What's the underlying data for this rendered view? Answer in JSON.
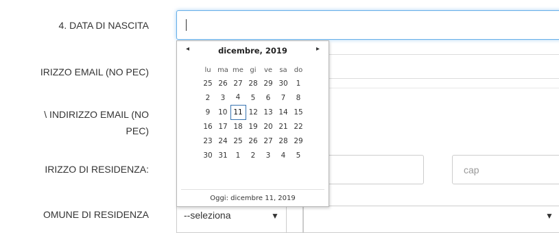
{
  "form": {
    "birth_date_label": "4. DATA DI NASCITA",
    "email_label": "IRIZZO EMAIL (NO PEC)",
    "confirm_email_label_line1": "\\ INDIRIZZO EMAIL (NO",
    "confirm_email_label_line2": "PEC)",
    "address_label": "IRIZZO DI RESIDENZA:",
    "municipality_label": "OMUNE DI RESIDENZA",
    "cap_placeholder": "cap",
    "municipality_select_value": "--seleziona"
  },
  "calendar": {
    "month_title": "dicembre, 2019",
    "prev_icon": "◂",
    "next_icon": "▸",
    "weekdays": [
      "lu",
      "ma",
      "me",
      "gi",
      "ve",
      "sa",
      "do"
    ],
    "weeks": [
      [
        "25",
        "26",
        "27",
        "28",
        "29",
        "30",
        "1"
      ],
      [
        "2",
        "3",
        "4",
        "5",
        "6",
        "7",
        "8"
      ],
      [
        "9",
        "10",
        "11",
        "12",
        "13",
        "14",
        "15"
      ],
      [
        "16",
        "17",
        "18",
        "19",
        "20",
        "21",
        "22"
      ],
      [
        "23",
        "24",
        "25",
        "26",
        "27",
        "28",
        "29"
      ],
      [
        "30",
        "31",
        "1",
        "2",
        "3",
        "4",
        "5"
      ]
    ],
    "selected_day": "11",
    "footer": "Oggi: dicembre 11, 2019"
  },
  "icons": {
    "select_arrow": "▼"
  }
}
